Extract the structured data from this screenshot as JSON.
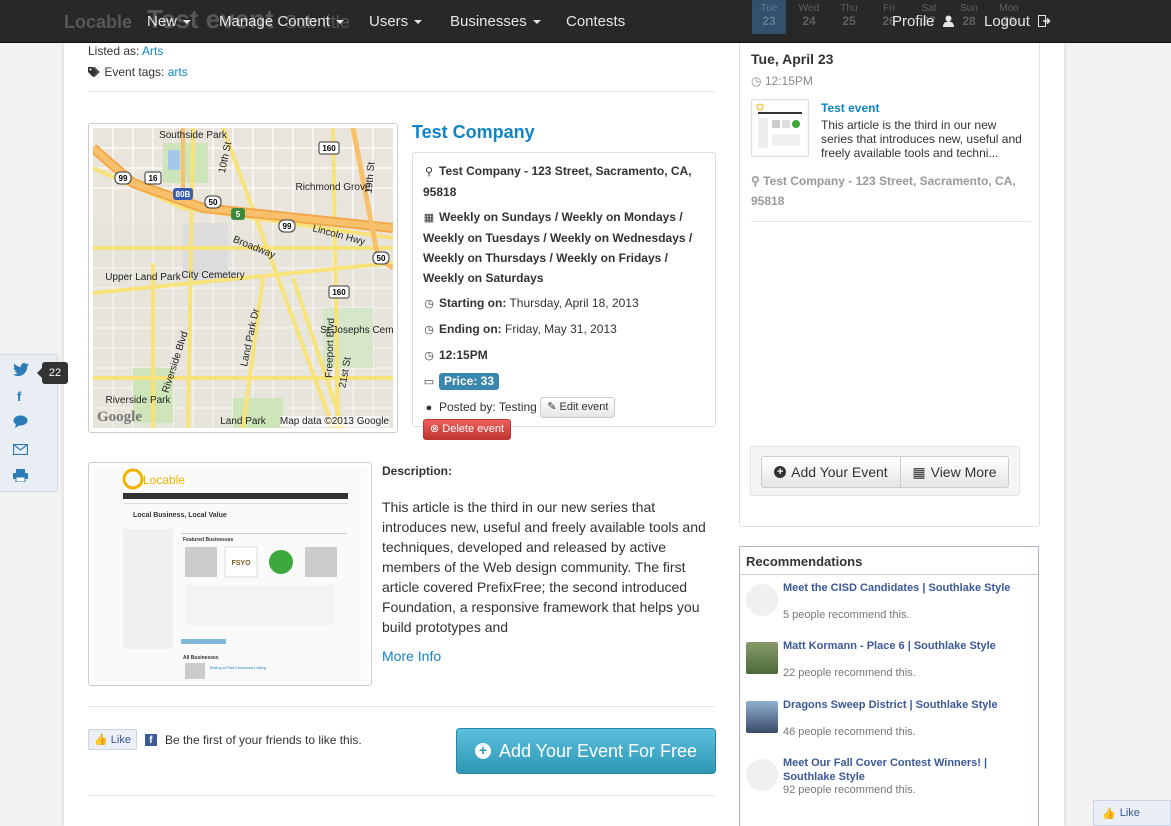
{
  "nav": {
    "ghost_brand": "Locable",
    "ghost_title": "Test event",
    "ghost_sub": "Sub title",
    "items": [
      "New",
      "Manage Content",
      "Users",
      "Businesses",
      "Contests"
    ],
    "profile": "Profile",
    "logout": "Logout",
    "calendar_ghost": [
      {
        "dow": "Tue",
        "day": "23"
      },
      {
        "dow": "Wed",
        "day": "24"
      },
      {
        "dow": "Thu",
        "day": "25"
      },
      {
        "dow": "Fri",
        "day": "26"
      },
      {
        "dow": "Sat",
        "day": "27"
      },
      {
        "dow": "Sun",
        "day": "28"
      },
      {
        "dow": "Mon",
        "day": "29"
      }
    ]
  },
  "event": {
    "listed_label": "Listed as:",
    "listed_value": "Arts",
    "tags_label": "Event tags:",
    "tags_value": "arts",
    "company": "Test Company",
    "location": "Test Company - 123 Street, Sacramento, CA, 95818",
    "schedule": "Weekly on Sundays / Weekly on Mondays / Weekly on Tuesdays / Weekly on Wednesdays / Weekly on Thursdays / Weekly on Fridays / Weekly on Saturdays",
    "start_label": "Starting on:",
    "start_value": "Thursday, April 18, 2013",
    "end_label": "Ending on:",
    "end_value": "Friday, May 31, 2013",
    "time": "12:15PM",
    "price": "Price: 33",
    "posted_label": "Posted by:",
    "posted_value": "Testing",
    "edit_btn": "Edit event",
    "delete_btn": "Delete event",
    "desc_heading": "Description:",
    "description": "This article is the third in our new series that introduces new, useful and freely available tools and techniques, developed and released by active members of the Web design community. The first article covered PrefixFree; the second introduced Foundation, a responsive framework that helps you build prototypes and",
    "more_info": "More Info",
    "like_btn": "Like",
    "like_text": "Be the first of your friends to like this.",
    "add_free_btn": "Add Your Event For Free"
  },
  "map": {
    "credit": "Map data ©2013 Google",
    "logo": "Google",
    "labels": [
      "Southside Park",
      "Richmond Grove",
      "Broadway",
      "Lincoln Hwy",
      "City Cemetery",
      "Upper Land Park",
      "Riverside Blvd",
      "Land Park Dr",
      "Freeport Blvd",
      "St Josephs Cemetery",
      "Riverside Park",
      "Land Park",
      "10th St",
      "19th St",
      "21st St"
    ],
    "shields": [
      "99",
      "16",
      "80B",
      "50",
      "160",
      "5",
      "99",
      "50",
      "160"
    ]
  },
  "thumb": {
    "brand": "Locable",
    "heading": "Local Business, Local Value",
    "featured": "Featured Businesses",
    "all": "All Businesses",
    "listing": "Testing a Paid Enhanced Listing"
  },
  "sidebar": {
    "date": "Tue, April 23",
    "time": "12:15PM",
    "item_title": "Test event",
    "item_text": "This article is the third in our new series that introduces new, useful and freely available tools and techni...",
    "location": "Test Company - 123 Street, Sacramento, CA, 95818",
    "add_btn": "Add Your Event",
    "view_btn": "View More"
  },
  "recommendations": {
    "heading": "Recommendations",
    "items": [
      {
        "title": "Meet the CISD Candidates | Southlake Style",
        "sub": "5 people recommend this."
      },
      {
        "title": "Matt Kormann - Place 6 | Southlake Style",
        "sub": "22 people recommend this."
      },
      {
        "title": "Dragons Sweep District | Southlake Style",
        "sub": "46 people recommend this."
      },
      {
        "title": "Meet Our Fall Cover Contest Winners! | Southlake Style",
        "sub": "92 people recommend this."
      }
    ]
  },
  "share": {
    "count": "22"
  },
  "corner_like": "Like",
  "colors": {
    "link": "#0f85c8",
    "navbar": "#282828",
    "info": "#2f96b4",
    "danger": "#bd362f",
    "facebook": "#3b5998"
  }
}
